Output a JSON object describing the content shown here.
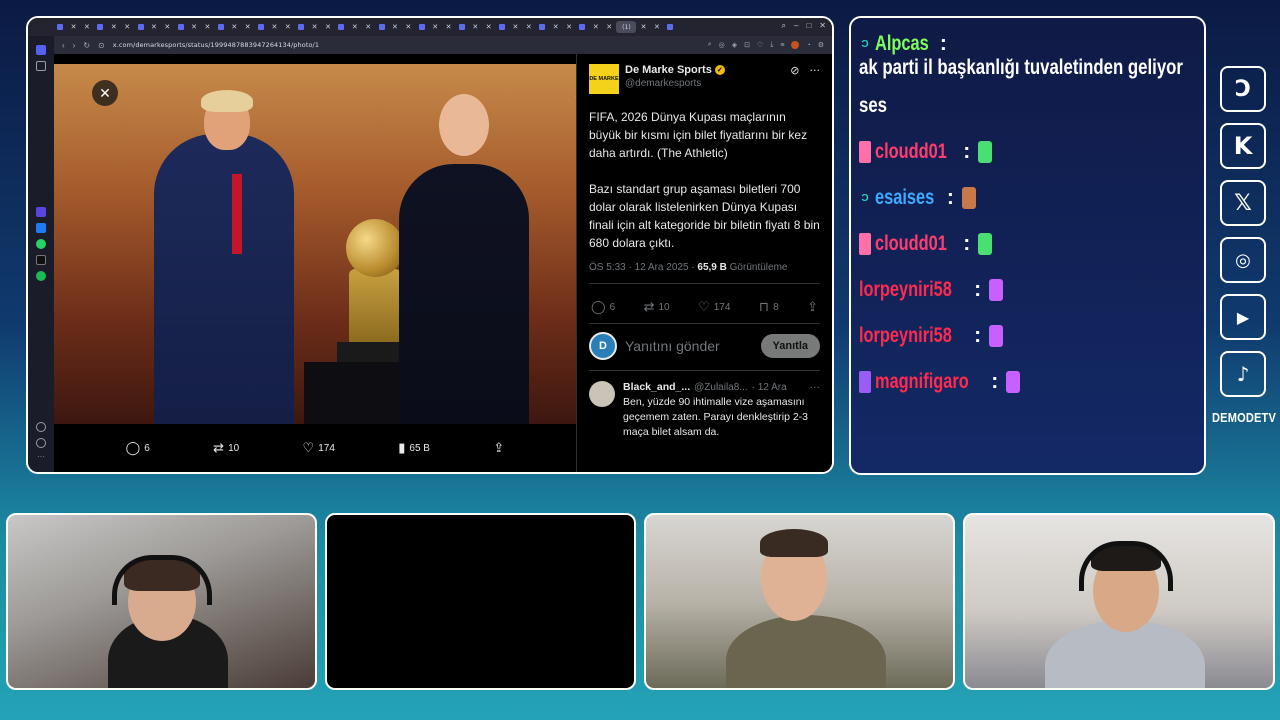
{
  "browser": {
    "url": "x.com/demarkesports/status/1999487883947264134/photo/1",
    "active_tab_label": "(1)",
    "tab_count": 46
  },
  "photo": {
    "close_icon": "close-icon",
    "expand_icon": "double-chevron-right-icon",
    "actions": {
      "replies": "6",
      "reposts": "10",
      "likes": "174",
      "views": "65 B"
    }
  },
  "tweet": {
    "author_name": "De Marke Sports",
    "author_handle": "@demarkesports",
    "avatar_text": "DE MARKE",
    "text": "FIFA, 2026 Dünya Kupası maçlarının büyük bir kısmı için bilet fiyatlarını bir kez daha artırdı. (The Athletic)\n\nBazı standart grup aşaması biletleri 700 dolar olarak listelenirken Dünya Kupası finali için alt kategoride bir biletin fiyatı 8 bin 680 dolara çıktı.",
    "time": "ÖS 5:33 · 12 Ara 2025 · ",
    "views_value": "65,9 B",
    "views_label": " Görüntüleme",
    "stats": {
      "replies": "6",
      "reposts": "10",
      "likes": "174",
      "bookmarks": "8"
    },
    "reply_placeholder": "Yanıtını gönder",
    "reply_button": "Yanıtla",
    "comment": {
      "name": "Black_and_...",
      "handle": "@Zulaila8...",
      "date": "· 12 Ara",
      "text": "Ben, yüzde 90 ihtimalle vize aşamasını geçemem zaten. Parayı denkleştirip 2-3 maça bilet alsam da."
    }
  },
  "chat": {
    "messages": [
      {
        "user": "Alpcas",
        "color": "#7dff5a",
        "badge": "teal",
        "text": "ak parti il başkanlığı tuvaletinden geliyor",
        "text2": "ses"
      },
      {
        "user": "cloudd01",
        "color": "#ff3d6e",
        "badge": "pink",
        "emote": "#48e070"
      },
      {
        "user": "esaises",
        "color": "#3fa9ff",
        "badge": "teal",
        "emote": "#c9784a"
      },
      {
        "user": "cloudd01",
        "color": "#ff3d6e",
        "badge": "pink",
        "emote": "#48e070"
      },
      {
        "user": "lorpeyniri58",
        "color": "#ff2a4e",
        "badge": "none",
        "emote": "#c860ff"
      },
      {
        "user": "lorpeyniri58",
        "color": "#ff2a4e",
        "badge": "none",
        "emote": "#c860ff"
      },
      {
        "user": "magnifigaro",
        "color": "#ff2a4e",
        "badge": "purple",
        "emote": "#c860ff"
      }
    ]
  },
  "socials": {
    "label": "DEMODETV",
    "items": [
      "demode-icon",
      "kick-icon",
      "x-icon",
      "instagram-icon",
      "youtube-icon",
      "tiktok-icon"
    ]
  }
}
